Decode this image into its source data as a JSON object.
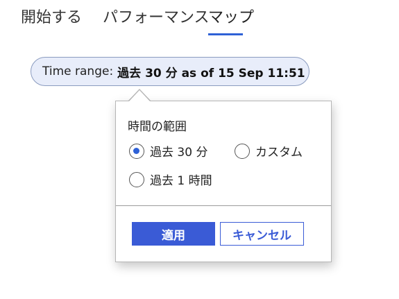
{
  "tabs": {
    "start": "開始する",
    "performance": "パフォーマンス",
    "map": "マップ",
    "selected": "map"
  },
  "time_range": {
    "label": "Time range:",
    "value": "過去 30 分 as of 15 Sep 11:51"
  },
  "popup": {
    "title": "時間の範囲",
    "options": [
      {
        "label": "過去 30 分",
        "checked": true
      },
      {
        "label": "カスタム",
        "checked": false
      },
      {
        "label": "過去 1 時間",
        "checked": false
      }
    ],
    "apply_label": "適用",
    "cancel_label": "キャンセル"
  },
  "colors": {
    "accent": "#3a5bd6",
    "pill_background": "#e8edfa"
  }
}
